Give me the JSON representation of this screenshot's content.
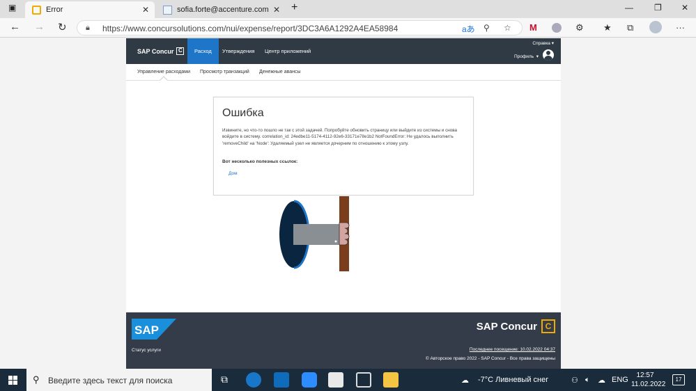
{
  "browser": {
    "tabs": [
      {
        "title": "Error"
      },
      {
        "title": "sofia.forte@accenture.com"
      }
    ],
    "new_tab": "+",
    "url": "https://www.concursolutions.com/nui/expense/report/3DC3A6A1292A4EA58984",
    "read_aloud": "aあ"
  },
  "app": {
    "logo": "SAP Concur",
    "logo_mark": "C",
    "nav": [
      "Расход",
      "Утверждения",
      "Центр приложений"
    ],
    "help": "Справка ▾",
    "profile": "Профиль",
    "profile_caret": "▾",
    "subnav": [
      "Управление расходами",
      "Просмотр транзакций",
      "Денежные авансы"
    ]
  },
  "error": {
    "title": "Ошибка",
    "message": "Извините, но что-то пошло не так с этой задачей. Попробуйте обновить страницу или выйдите из системы и снова войдите в систему. correlation_id: 24edbe11-5174-4112-92e6-33171e78e1b2 NotFoundError: Не удалось выполнить 'removeChild' на 'Node': Удаляемый узел не является дочерним по отношению к этому узлу.",
    "links_title": "Вот несколько полезных ссылок:",
    "home_link": "Дом"
  },
  "footer": {
    "sap": "SAP",
    "status": "Статус услуги",
    "brand": "SAP Concur",
    "brand_mark": "C",
    "last_visit": "Последнее посещение: 10.02.2022 04:37",
    "copyright": "© Авторское право 2022 - SAP Concur - Все права защищены"
  },
  "taskbar": {
    "search_placeholder": "Введите здесь текст для поиска",
    "weather": "-7°C  Ливневый снег",
    "lang": "ENG",
    "time": "12:57",
    "date": "11.02.2022",
    "notifications": "17"
  },
  "colors": {
    "topnav": "#2f3a45",
    "active_tab": "#1f75c7",
    "footer": "#333c48",
    "accent": "#f0ab00"
  }
}
